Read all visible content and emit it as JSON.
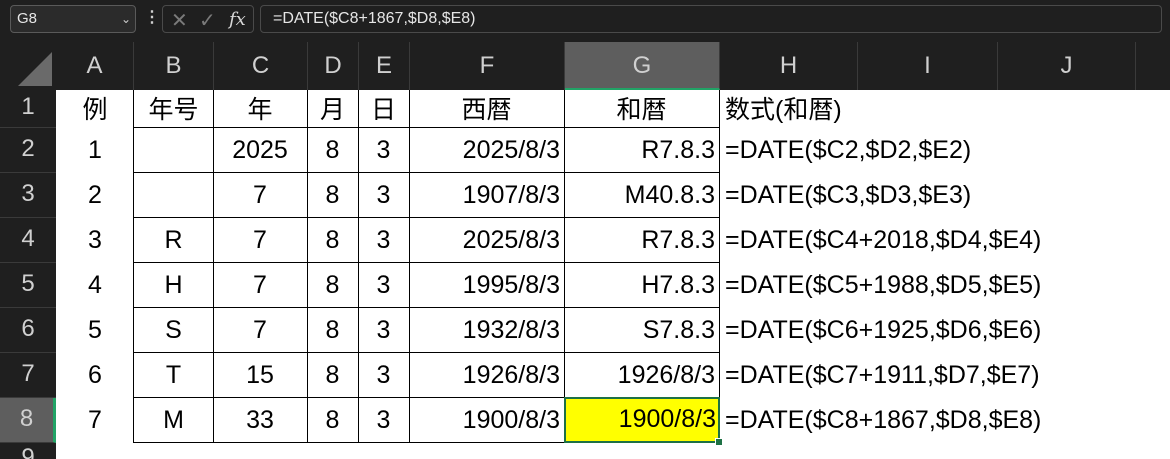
{
  "formula_bar": {
    "name_box": "G8",
    "formula": "=DATE($C8+1867,$D8,$E8)"
  },
  "icons": {
    "dropdown": "chevron-down-icon",
    "cancel": "close-icon",
    "enter": "check-icon",
    "function": "fx-icon",
    "more": "more-vertical-icon"
  },
  "columns": [
    "A",
    "B",
    "C",
    "D",
    "E",
    "F",
    "G",
    "H",
    "I",
    "J"
  ],
  "rows": [
    "1",
    "2",
    "3",
    "4",
    "5",
    "6",
    "7",
    "8",
    "9"
  ],
  "selected_cell": {
    "column": "G",
    "row": "8"
  },
  "colors": {
    "highlight": "#ffff00",
    "selection": "#21a366"
  },
  "sheet": {
    "headers": [
      "例",
      "年号",
      "年",
      "月",
      "日",
      "西暦",
      "和暦",
      "数式(和暦)"
    ],
    "rows": [
      [
        "1",
        "",
        "2025",
        "8",
        "3",
        "2025/8/3",
        "R7.8.3",
        "=DATE($C2,$D2,$E2)"
      ],
      [
        "2",
        "",
        "7",
        "8",
        "3",
        "1907/8/3",
        "M40.8.3",
        "=DATE($C3,$D3,$E3)"
      ],
      [
        "3",
        "R",
        "7",
        "8",
        "3",
        "2025/8/3",
        "R7.8.3",
        "=DATE($C4+2018,$D4,$E4)"
      ],
      [
        "4",
        "H",
        "7",
        "8",
        "3",
        "1995/8/3",
        "H7.8.3",
        "=DATE($C5+1988,$D5,$E5)"
      ],
      [
        "5",
        "S",
        "7",
        "8",
        "3",
        "1932/8/3",
        "S7.8.3",
        "=DATE($C6+1925,$D6,$E6)"
      ],
      [
        "6",
        "T",
        "15",
        "8",
        "3",
        "1926/8/3",
        "1926/8/3",
        "=DATE($C7+1911,$D7,$E7)"
      ],
      [
        "7",
        "M",
        "33",
        "8",
        "3",
        "1900/8/3",
        "1900/8/3",
        "=DATE($C8+1867,$D8,$E8)"
      ]
    ]
  }
}
